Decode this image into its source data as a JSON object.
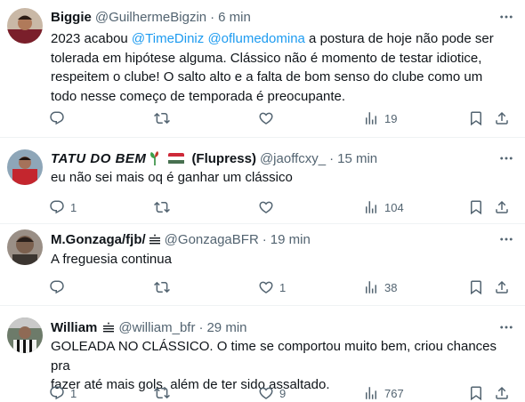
{
  "tweets": [
    {
      "name": "Biggie",
      "handle": "@GuilhermeBigzin",
      "time": "6 min",
      "text_pre": "2023 acabou ",
      "mention1": "@TimeDiniz",
      "mention2": "@oflumedomina",
      "text_post1": " a postura de hoje não pode ser",
      "lines": [
        "tolerada em hipótese alguma. Clássico não é momento de testar idiotice,",
        "respeitem o clube! O salto alto e a falta de bom senso do clube como um",
        "todo nesse começo de temporada é preocupante."
      ],
      "replies": "",
      "retweets": "",
      "likes": "",
      "views": "19"
    },
    {
      "name": "TATU DO BEM",
      "name_suffix": "(Flupress)",
      "handle": "@jaoffcxy_",
      "time": "15 min",
      "text": "eu não sei mais oq é ganhar um clássico",
      "replies": "1",
      "retweets": "",
      "likes": "",
      "views": "104"
    },
    {
      "name": "M.Gonzaga/fjb/",
      "handle": "@GonzagaBFR",
      "time": "19 min",
      "text": "A freguesia continua",
      "replies": "",
      "retweets": "",
      "likes": "1",
      "views": "38"
    },
    {
      "name": "William",
      "handle": "@william_bfr",
      "time": "29 min",
      "lines": [
        "GOLEADA NO CLÁSSICO. O time se comportou muito bem, criou chances pra",
        "fazer até mais gols, além de ter sido assaltado."
      ],
      "replies": "1",
      "retweets": "",
      "likes": "9",
      "views": "767"
    }
  ],
  "icons": {
    "reply": "reply-icon",
    "retweet": "retweet-icon",
    "like": "heart-icon",
    "views": "views-chart-icon",
    "bookmark": "bookmark-icon",
    "share": "share-icon",
    "more": "more-icon"
  },
  "colors": {
    "text": "#0f1419",
    "secondary": "#536471",
    "mention": "#1d9bf0",
    "divider": "#eff3f4"
  }
}
